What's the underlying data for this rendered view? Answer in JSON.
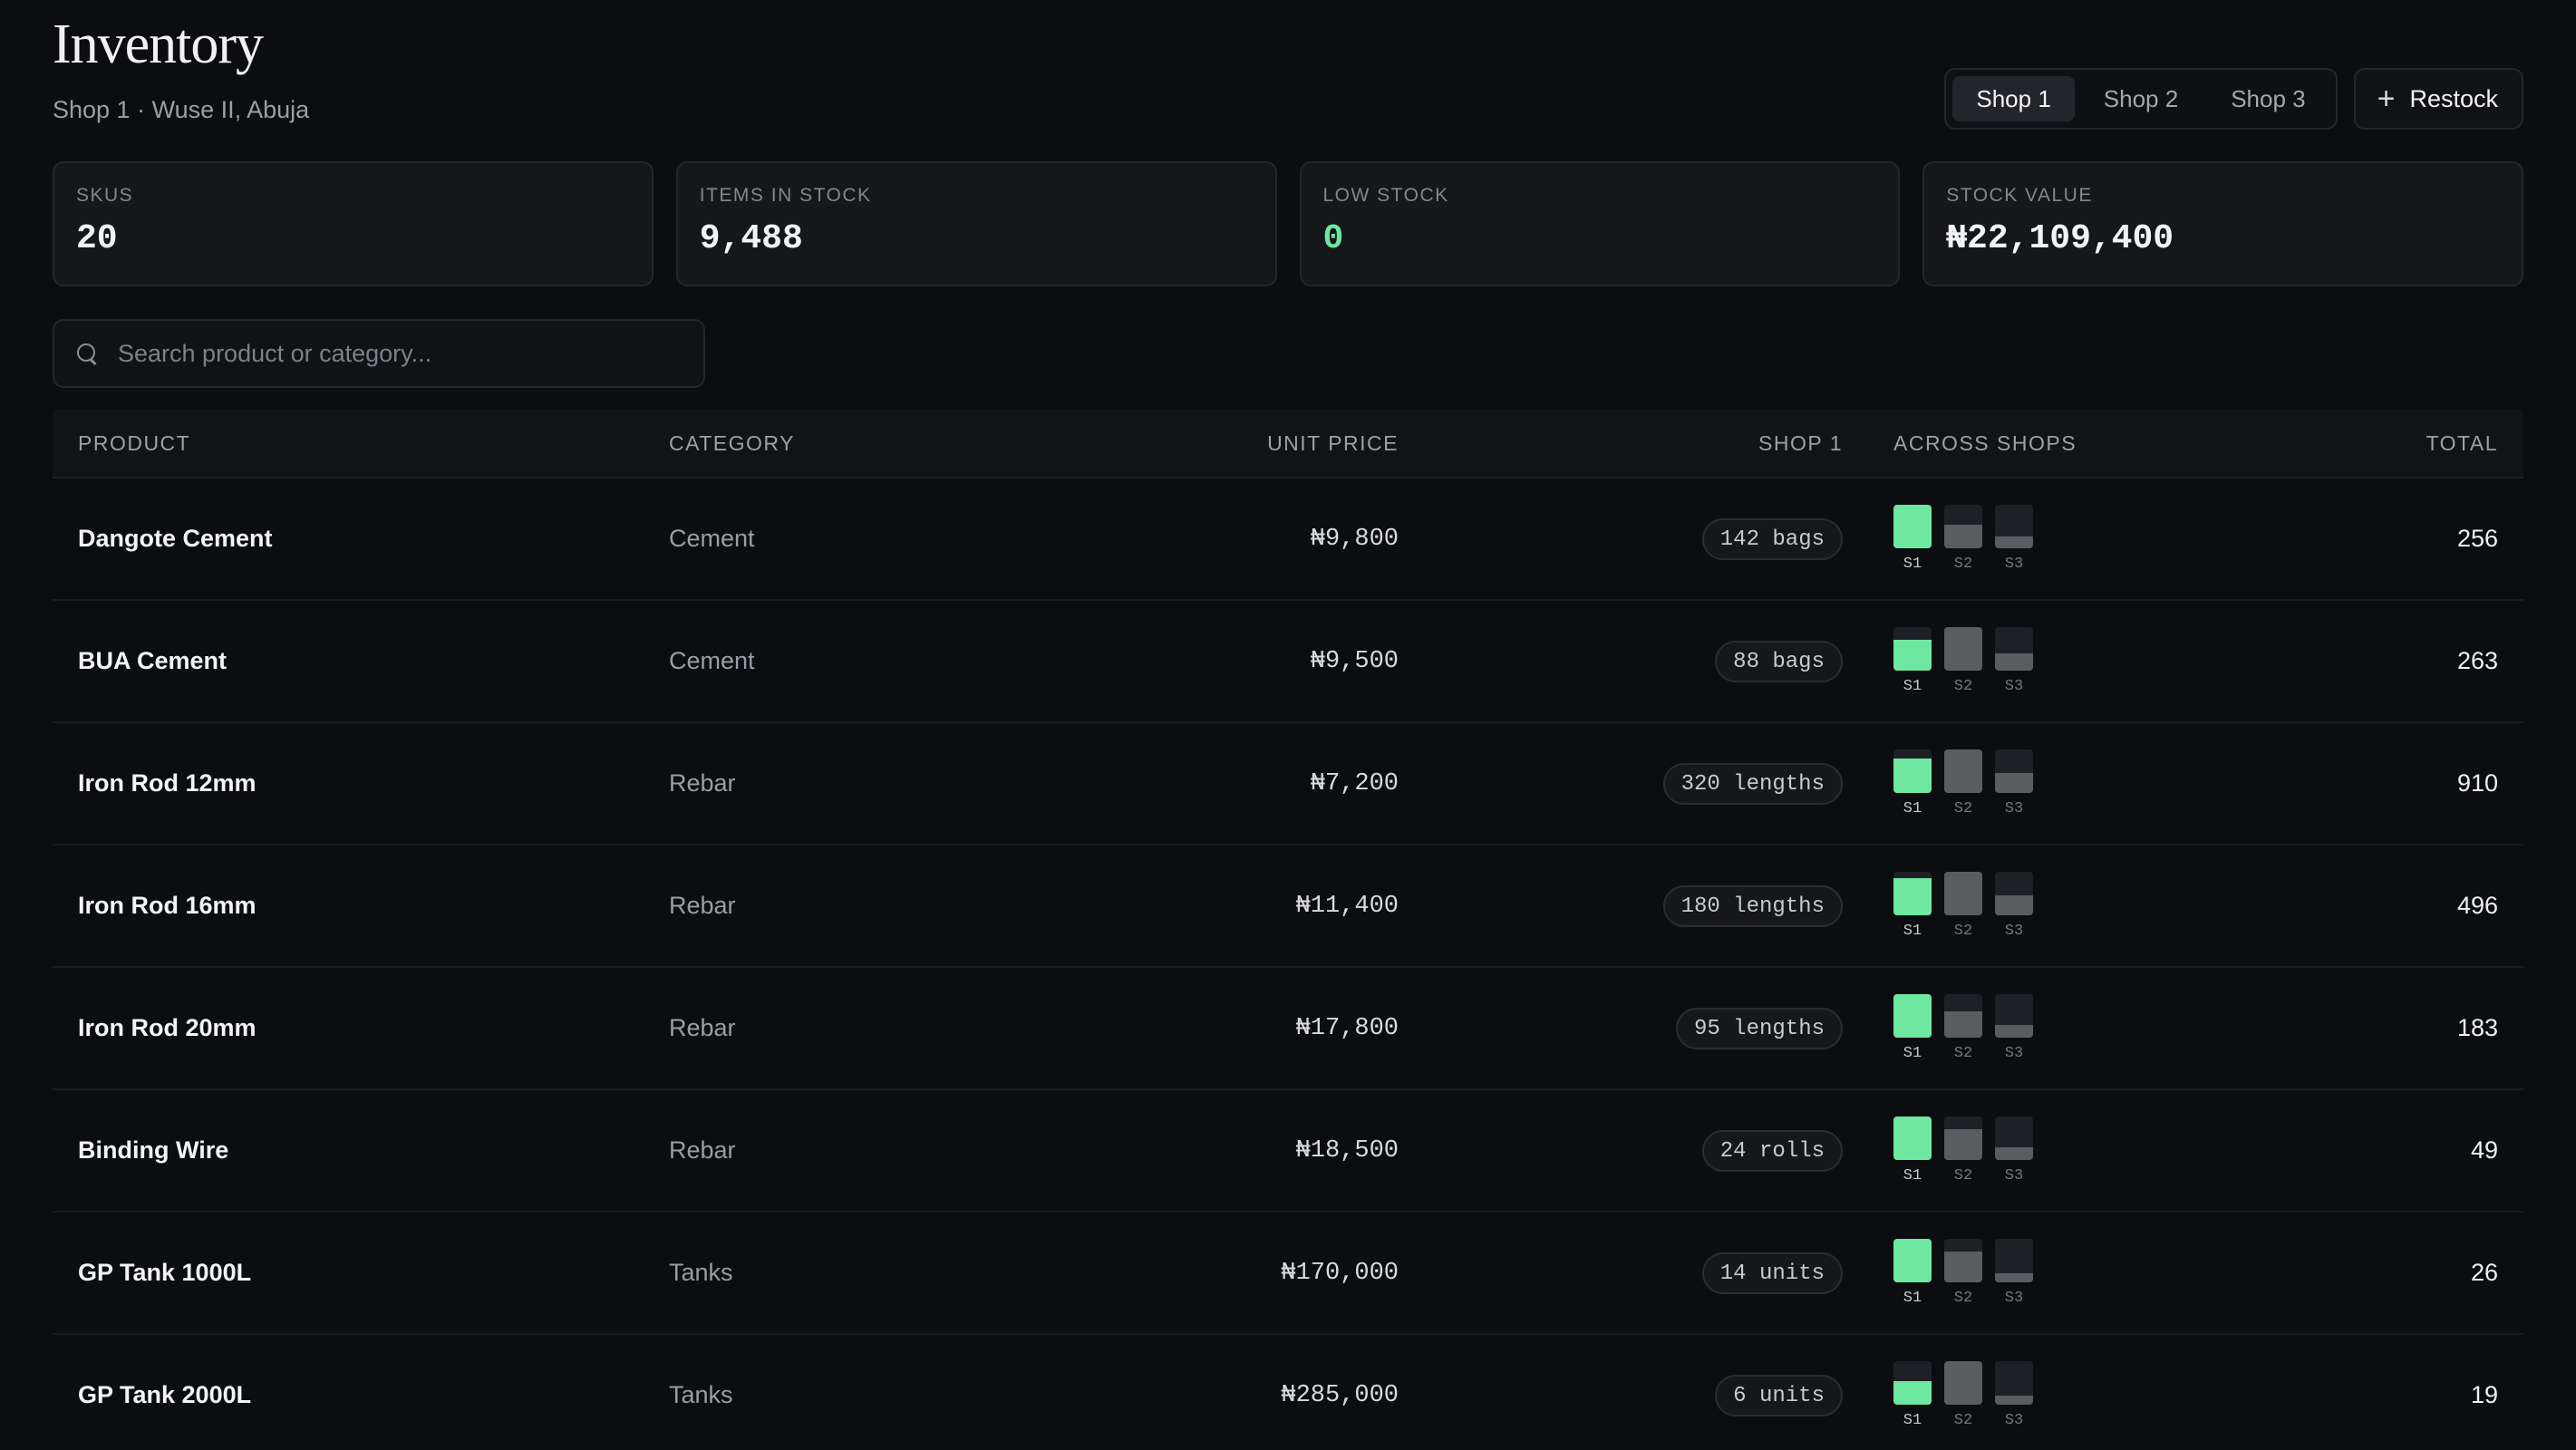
{
  "header": {
    "title": "Inventory",
    "subtitle": "Shop 1 · Wuse II, Abuja",
    "shop_tabs": [
      "Shop 1",
      "Shop 2",
      "Shop 3"
    ],
    "active_tab": "Shop 1",
    "restock_label": "Restock",
    "restock_icon": "plus-icon"
  },
  "stats": [
    {
      "label": "SKUS",
      "value": "20"
    },
    {
      "label": "ITEMS IN STOCK",
      "value": "9,488"
    },
    {
      "label": "LOW STOCK",
      "value": "0"
    },
    {
      "label": "STOCK VALUE",
      "value": "₦22,109,400"
    }
  ],
  "search": {
    "placeholder": "Search product or category...",
    "value": ""
  },
  "table": {
    "columns": {
      "product": "PRODUCT",
      "category": "CATEGORY",
      "unit_price": "UNIT PRICE",
      "shop": "SHOP 1",
      "across": "ACROSS SHOPS",
      "total": "TOTAL"
    },
    "bar_labels": [
      "S1",
      "S2",
      "S3"
    ],
    "colors": {
      "s1": "#6ee7a0",
      "other": "#5b5c60"
    },
    "rows": [
      {
        "product": "Dangote Cement",
        "category": "Cement",
        "price": "₦9,800",
        "shop_qty": "142 bags",
        "levels": [
          1.0,
          0.55,
          0.28
        ],
        "total": "256"
      },
      {
        "product": "BUA Cement",
        "category": "Cement",
        "price": "₦9,500",
        "shop_qty": "88 bags",
        "levels": [
          0.7,
          1.0,
          0.4
        ],
        "total": "263"
      },
      {
        "product": "Iron Rod 12mm",
        "category": "Rebar",
        "price": "₦7,200",
        "shop_qty": "320 lengths",
        "levels": [
          0.8,
          1.0,
          0.45
        ],
        "total": "910"
      },
      {
        "product": "Iron Rod 16mm",
        "category": "Rebar",
        "price": "₦11,400",
        "shop_qty": "180 lengths",
        "levels": [
          0.85,
          1.0,
          0.45
        ],
        "total": "496"
      },
      {
        "product": "Iron Rod 20mm",
        "category": "Rebar",
        "price": "₦17,800",
        "shop_qty": "95 lengths",
        "levels": [
          1.0,
          0.6,
          0.3
        ],
        "total": "183"
      },
      {
        "product": "Binding Wire",
        "category": "Rebar",
        "price": "₦18,500",
        "shop_qty": "24 rolls",
        "levels": [
          1.0,
          0.7,
          0.3
        ],
        "total": "49"
      },
      {
        "product": "GP Tank 1000L",
        "category": "Tanks",
        "price": "₦170,000",
        "shop_qty": "14 units",
        "levels": [
          1.0,
          0.7,
          0.2
        ],
        "total": "26"
      },
      {
        "product": "GP Tank 2000L",
        "category": "Tanks",
        "price": "₦285,000",
        "shop_qty": "6 units",
        "levels": [
          0.55,
          1.0,
          0.2
        ],
        "total": "19"
      }
    ]
  }
}
